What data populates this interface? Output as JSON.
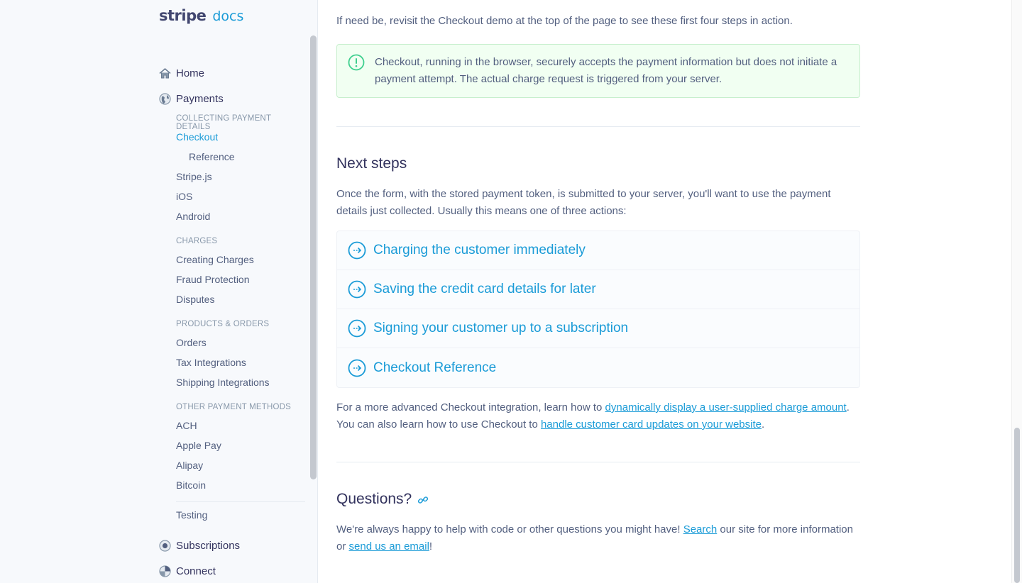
{
  "logo": {
    "word": "stripe",
    "suffix": "docs"
  },
  "sidebar": {
    "home": "Home",
    "payments": "Payments",
    "sections": [
      {
        "heading": "COLLECTING PAYMENT DETAILS",
        "items": [
          "Checkout",
          "Reference",
          "Stripe.js",
          "iOS",
          "Android"
        ]
      },
      {
        "heading": "CHARGES",
        "items": [
          "Creating Charges",
          "Fraud Protection",
          "Disputes"
        ]
      },
      {
        "heading": "PRODUCTS & ORDERS",
        "items": [
          "Orders",
          "Tax Integrations",
          "Shipping Integrations"
        ]
      },
      {
        "heading": "OTHER PAYMENT METHODS",
        "items": [
          "ACH",
          "Apple Pay",
          "Alipay",
          "Bitcoin"
        ]
      }
    ],
    "testing": "Testing",
    "subscriptions": "Subscriptions",
    "connect": "Connect",
    "active_item": "Checkout"
  },
  "main": {
    "intro": "If need be, revisit the Checkout demo at the top of the page to see these first four steps in action.",
    "note": "Checkout, running in the browser, securely accepts the payment information but does not initiate a payment attempt. The actual charge request is triggered from your server.",
    "next_steps_title": "Next steps",
    "next_steps_body": "Once the form, with the stored payment token, is submitted to your server, you'll want to use the payment details just collected. Usually this means one of three actions:",
    "steps": [
      "Charging the customer immediately",
      "Saving the credit card details for later",
      "Signing your customer up to a subscription",
      "Checkout Reference"
    ],
    "advanced": {
      "pre": "For a more advanced Checkout integration, learn how to ",
      "link1": "dynamically display a user-supplied charge amount",
      "mid": ". You can also learn how to use Checkout to ",
      "link2": "handle customer card updates on your website",
      "post": "."
    },
    "questions_title": "Questions?",
    "questions": {
      "pre": "We're always happy to help with code or other questions you might have! ",
      "link1": "Search",
      "mid": " our site for more information or ",
      "link2": "send us an email",
      "post": "!"
    }
  },
  "colors": {
    "accent": "#1a9bd7",
    "note_bg": "#f1fff2",
    "note_icon": "#3ecf8e",
    "sidebar_bg": "#f7f9fc"
  }
}
